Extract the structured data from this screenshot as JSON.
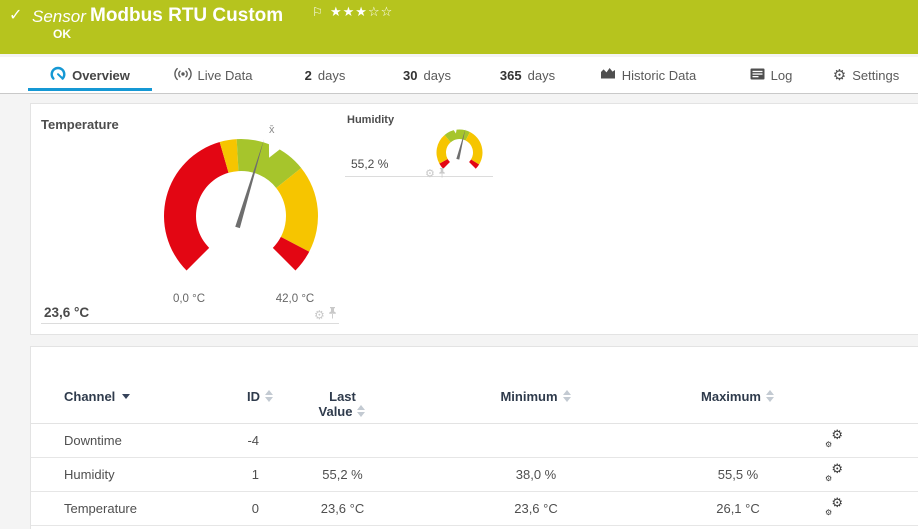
{
  "colors": {
    "header_bg": "#b6c41e",
    "accent_blue": "#1598d4",
    "gauge": {
      "red": "#e30613",
      "yellow": "#f6c500",
      "green": "#a6c52c"
    },
    "needle": "#6e6e6e"
  },
  "header": {
    "check_icon": "✓",
    "kind": "Sensor",
    "title": "Modbus RTU Custom",
    "flag_icon": "⚐",
    "stars": "★★★☆☆",
    "status": "OK"
  },
  "tabs": [
    {
      "label": "Overview",
      "icon": "gauge-icon",
      "active": true
    },
    {
      "label": "Live Data",
      "icon": "live-data-icon"
    },
    {
      "num": "2",
      "label": "days"
    },
    {
      "num": "30",
      "label": "days"
    },
    {
      "num": "365",
      "label": "days"
    },
    {
      "label": "Historic Data",
      "icon": "historic-data-icon"
    },
    {
      "label": "Log",
      "icon": "log-icon"
    },
    {
      "label": "Settings",
      "icon": "gear-icon"
    }
  ],
  "gauges": {
    "temperature": {
      "title": "Temperature",
      "value": 23.6,
      "value_label": "23,6 °C",
      "min": 0,
      "max": 42,
      "min_label": "0,0 °C",
      "max_label": "42,0 °C",
      "avg": 25,
      "avg_label": "x̄",
      "segments": [
        {
          "from": 0,
          "to": 18.5,
          "color": "red"
        },
        {
          "from": 18.5,
          "to": 20.5,
          "color": "yellow"
        },
        {
          "from": 20.5,
          "to": 29,
          "color": "green"
        },
        {
          "from": 29,
          "to": 39.3,
          "color": "yellow"
        },
        {
          "from": 39.3,
          "to": 42,
          "color": "red"
        }
      ]
    },
    "humidity": {
      "title": "Humidity",
      "value": 55.2,
      "value_label": "55,2 %",
      "min": 0,
      "max": 100,
      "avg": 46,
      "segments": [
        {
          "from": 0,
          "to": 6,
          "color": "red"
        },
        {
          "from": 6,
          "to": 35,
          "color": "yellow"
        },
        {
          "from": 35,
          "to": 60,
          "color": "green"
        },
        {
          "from": 60,
          "to": 95,
          "color": "yellow"
        },
        {
          "from": 95,
          "to": 100,
          "color": "red"
        }
      ]
    }
  },
  "table": {
    "headers": {
      "channel": "Channel",
      "id": "ID",
      "last": "Last Value",
      "min": "Minimum",
      "max": "Maximum"
    },
    "rows": [
      {
        "channel": "Downtime",
        "id": "-4",
        "last": "",
        "min": "",
        "max": ""
      },
      {
        "channel": "Humidity",
        "id": "1",
        "last": "55,2 %",
        "min": "38,0 %",
        "max": "55,5 %"
      },
      {
        "channel": "Temperature",
        "id": "0",
        "last": "23,6 °C",
        "min": "23,6 °C",
        "max": "26,1 °C"
      }
    ]
  }
}
